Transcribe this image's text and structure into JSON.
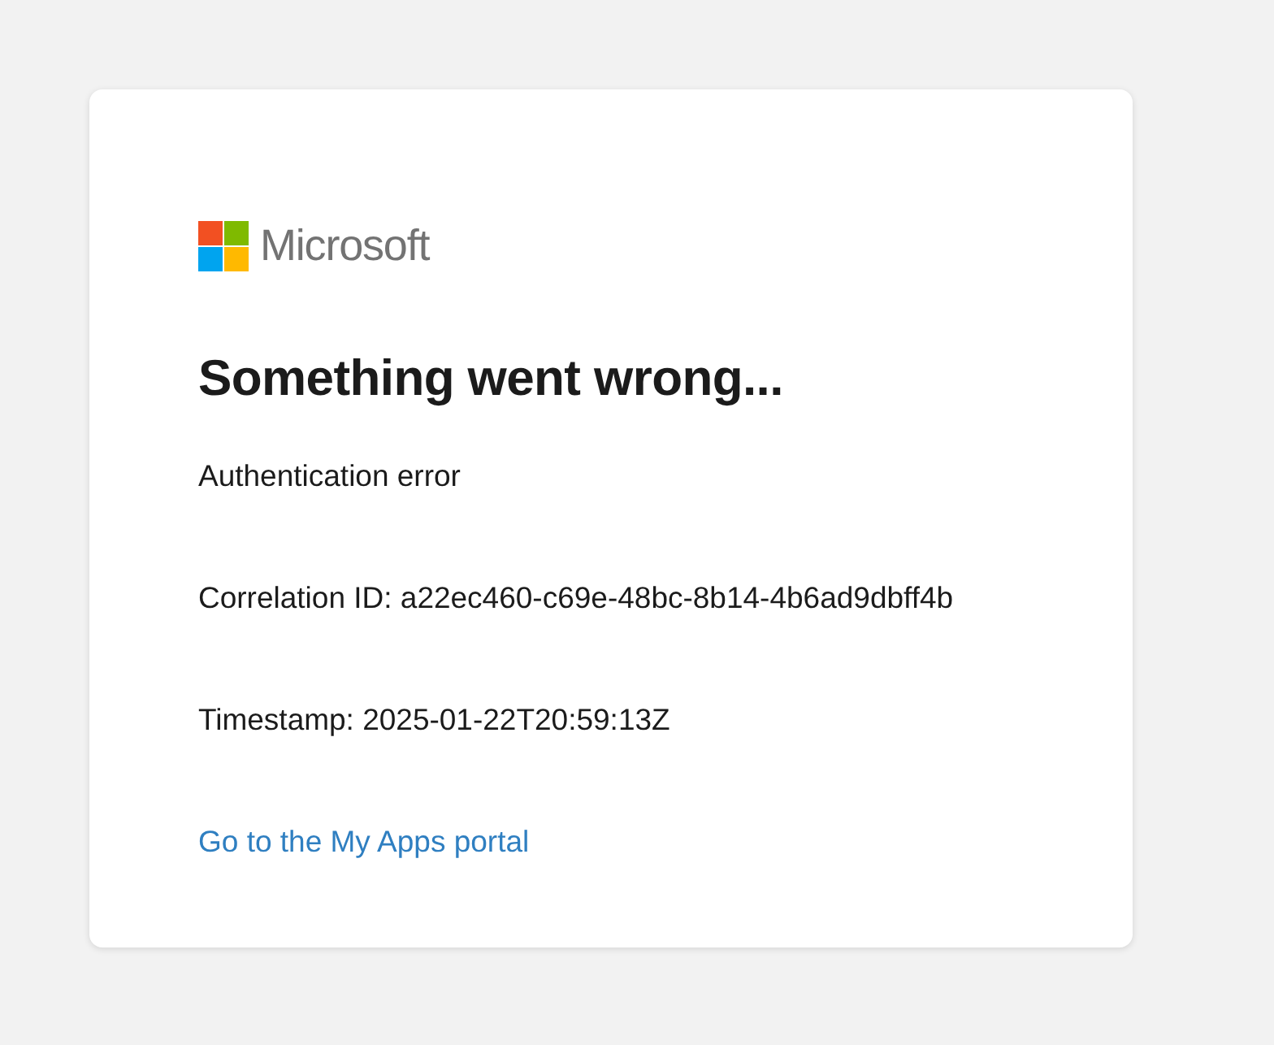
{
  "card": {
    "logo": {
      "wordmark": "Microsoft"
    },
    "title": "Something went wrong...",
    "messages": [
      "Authentication error",
      "Correlation ID: a22ec460-c69e-48bc-8b14-4b6ad9dbff4b",
      "Timestamp: 2025-01-22T20:59:13Z"
    ],
    "link": "Go to the My Apps portal"
  }
}
